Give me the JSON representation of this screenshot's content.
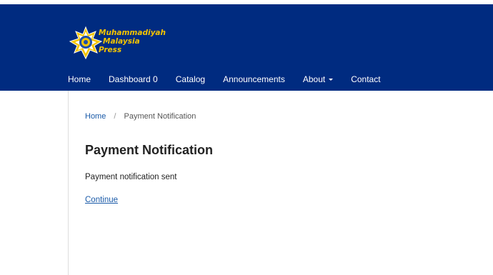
{
  "brand": {
    "logo_line1": "Muhammadiyah",
    "logo_line2": "Malaysia",
    "logo_line3": "Press",
    "header_color": "#002b80",
    "logo_text_color": "#f4c400"
  },
  "nav": {
    "items": [
      {
        "label": "Home"
      },
      {
        "label": "Dashboard 0"
      },
      {
        "label": "Catalog"
      },
      {
        "label": "Announcements"
      },
      {
        "label": "About"
      },
      {
        "label": "Contact"
      }
    ]
  },
  "breadcrumb": {
    "home": "Home",
    "separator": "/",
    "current": "Payment Notification"
  },
  "main": {
    "title": "Payment Notification",
    "message": "Payment notification sent",
    "continue_label": "Continue",
    "link_color": "#1a5aa8"
  }
}
